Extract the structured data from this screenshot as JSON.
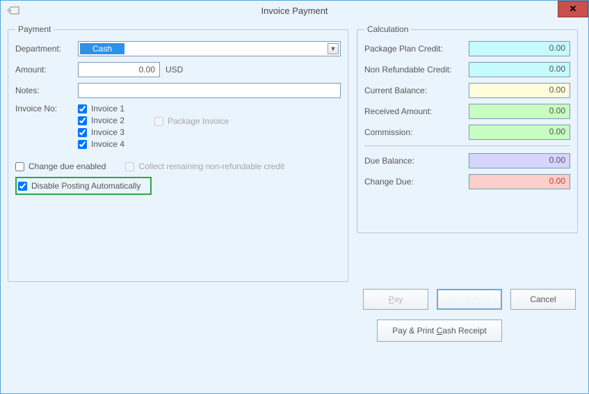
{
  "window": {
    "title": "Invoice Payment"
  },
  "payment": {
    "legend": "Payment",
    "department_label": "Department:",
    "department_value": "Cash",
    "amount_label": "Amount:",
    "amount_value": "0.00",
    "currency": "USD",
    "notes_label": "Notes:",
    "notes_value": "",
    "invoice_no_label": "Invoice No:",
    "invoices": [
      "Invoice 1",
      "Invoice 2",
      "Invoice 3",
      "Invoice 4"
    ],
    "package_invoice_label": "Package Invoice",
    "change_due_enabled_label": "Change due enabled",
    "collect_remaining_label": "Collect remaining non-refundable credit",
    "disable_posting_label": "Disable Posting Automatically"
  },
  "calculation": {
    "legend": "Calculation",
    "rows": {
      "package_plan_credit": {
        "label": "Package Plan Credit:",
        "value": "0.00"
      },
      "non_refundable_credit": {
        "label": "Non Refundable Credit:",
        "value": "0.00"
      },
      "current_balance": {
        "label": "Current Balance:",
        "value": "0.00"
      },
      "received_amount": {
        "label": "Received Amount:",
        "value": "0.00"
      },
      "commission": {
        "label": "Commission:",
        "value": "0.00"
      },
      "due_balance": {
        "label": "Due Balance:",
        "value": "0.00"
      },
      "change_due": {
        "label": "Change Due:",
        "value": "0.00"
      }
    }
  },
  "buttons": {
    "pay": "Pay",
    "pay_print": "Pay & Print",
    "cancel": "Cancel",
    "pay_print_cash": "Pay & Print Cash Receipt"
  }
}
